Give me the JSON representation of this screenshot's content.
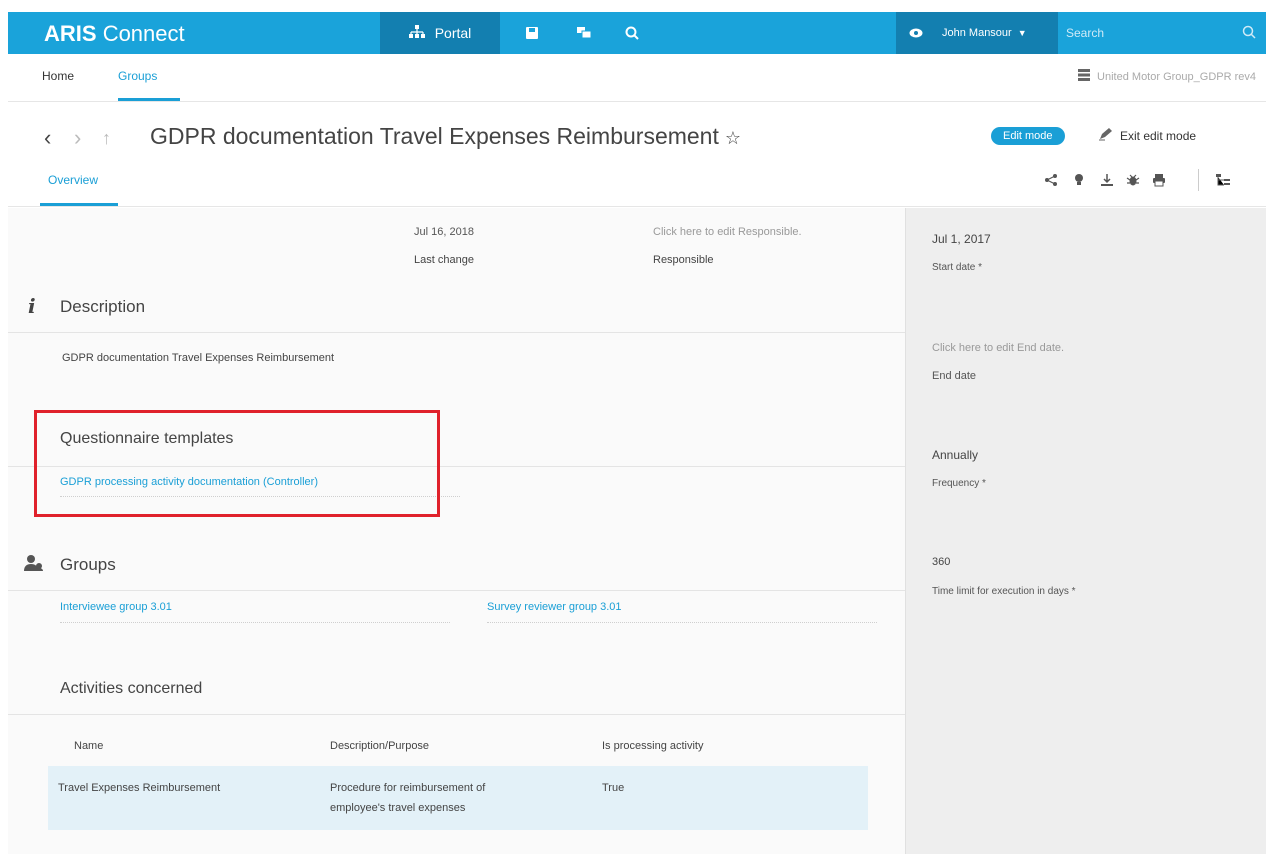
{
  "app": {
    "brand_bold": "ARIS",
    "brand_rest": "Connect"
  },
  "topbar": {
    "portal_label": "Portal",
    "user_name": "John Mansour",
    "search_placeholder": "Search"
  },
  "nav": {
    "home": "Home",
    "groups": "Groups",
    "database": "United Motor Group_GDPR rev4"
  },
  "page": {
    "title": "GDPR documentation Travel Expenses Reimbursement",
    "edit_mode_badge": "Edit mode",
    "exit_edit_mode": "Exit edit mode",
    "tab_overview": "Overview"
  },
  "summary": {
    "last_change_value": "Jul 16, 2018",
    "last_change_label": "Last change",
    "responsible_hint": "Click here to edit Responsible.",
    "responsible_label": "Responsible"
  },
  "description": {
    "title": "Description",
    "text": "GDPR documentation Travel Expenses Reimbursement"
  },
  "questionnaire": {
    "title": "Questionnaire templates",
    "link": "GDPR processing activity documentation (Controller)"
  },
  "groups": {
    "title": "Groups",
    "items": [
      "Interviewee group 3.01",
      "Survey reviewer group 3.01"
    ]
  },
  "activities": {
    "title": "Activities concerned",
    "columns": [
      "Name",
      "Description/Purpose",
      "Is processing activity"
    ],
    "rows": [
      {
        "name": "Travel Expenses Reimbursement",
        "description": "Procedure for reimbursement of employee's travel expenses",
        "is_processing": "True"
      }
    ]
  },
  "sidebar": {
    "start_value": "Jul 1, 2017",
    "start_label": "Start date *",
    "end_hint": "Click here to edit End date.",
    "end_label": "End date",
    "frequency_value": "Annually",
    "frequency_label": "Frequency *",
    "time_limit_value": "360",
    "time_limit_label": "Time limit for execution in days *"
  },
  "colors": {
    "topbar": "#1aa3da",
    "topbar_dark": "#137fb0",
    "accent": "#1a9fd6",
    "highlight": "#e0212b"
  }
}
